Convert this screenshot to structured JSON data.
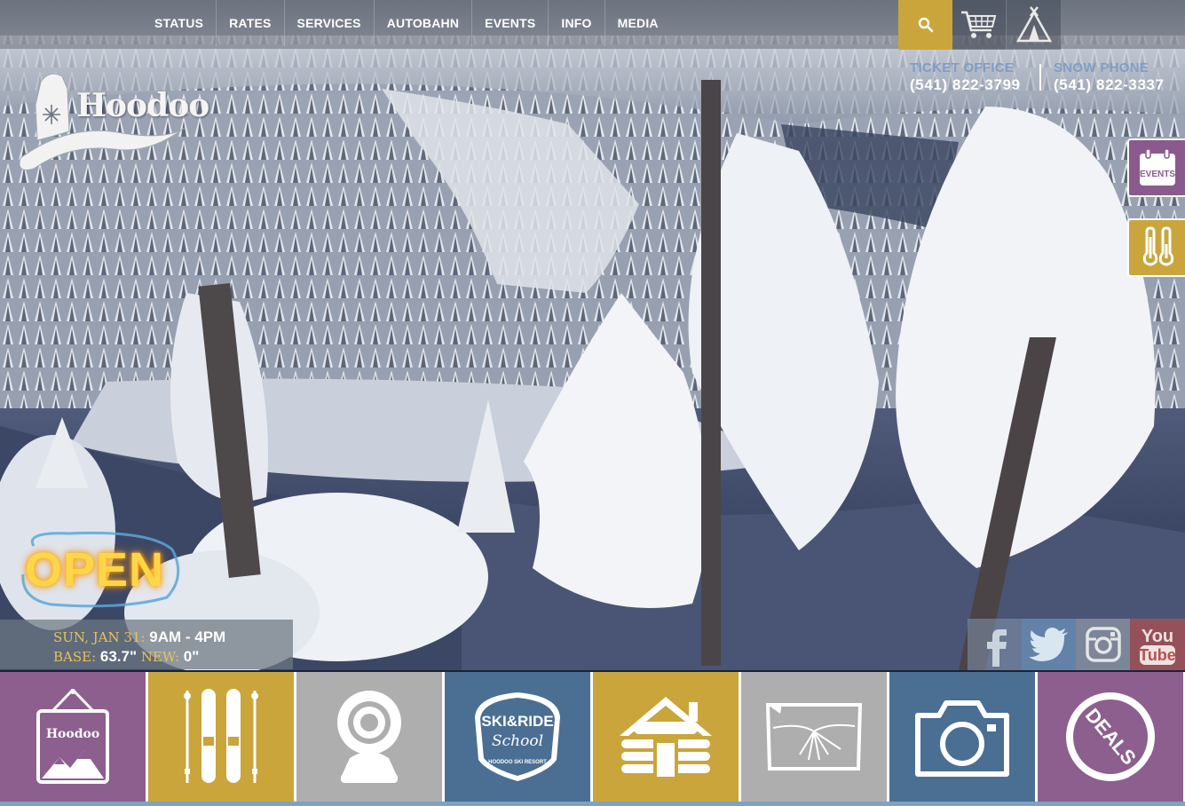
{
  "nav": {
    "items": [
      "STATUS",
      "RATES",
      "SERVICES",
      "AUTOBAHN",
      "EVENTS",
      "INFO",
      "MEDIA"
    ]
  },
  "utility": {
    "search_icon": "search-icon",
    "cart_icon": "cart-icon",
    "camping_icon": "teepee-icon"
  },
  "brand": {
    "logo_text": "Hoodoo"
  },
  "contact": {
    "ticket_label": "TICKET OFFICE",
    "ticket_phone": "(541) 822-3799",
    "snow_label": "SNOW PHONE",
    "snow_phone": "(541) 822-3337"
  },
  "side_tabs": {
    "events_label": "EVENTS",
    "weather_icon": "thermometer-icon"
  },
  "status": {
    "open_text": "OPEN",
    "date_label": "SUN, JAN 31:",
    "hours": "9AM - 4PM",
    "base_label": "BASE:",
    "base_value": "63.7\"",
    "new_label": "NEW:",
    "new_value": "0\""
  },
  "social": {
    "youtube_line1": "You",
    "youtube_line2": "Tube"
  },
  "tiles": {
    "skiride_line1": "SKI&RIDE",
    "skiride_line2": "School",
    "skiride_line3": "HOODOO SKI RESORT",
    "deals_label": "DEALS",
    "trail_logo": "Hoodoo"
  },
  "colors": {
    "purple": "#8c5f8f",
    "gold": "#c9a53b",
    "grey": "#aeaeae",
    "blue": "#4a6f93"
  }
}
